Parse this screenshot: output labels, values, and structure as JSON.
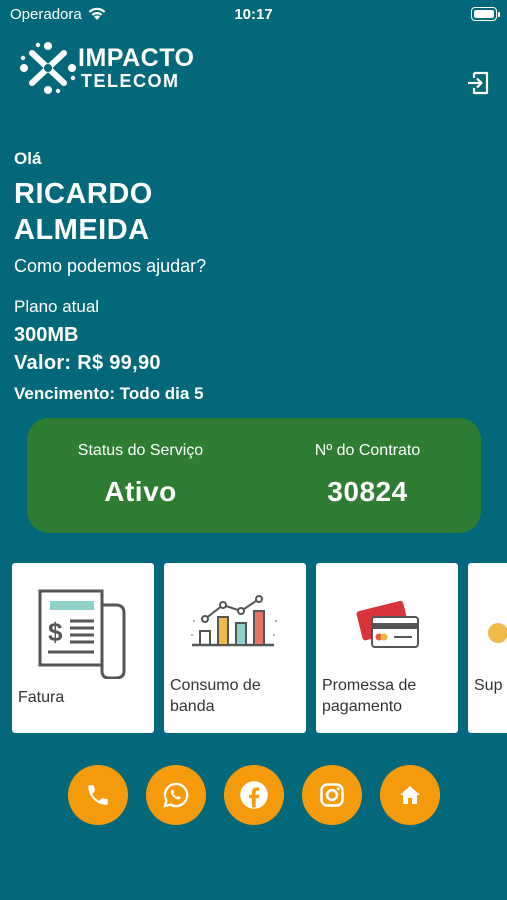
{
  "status_bar": {
    "carrier": "Operadora",
    "time": "10:17"
  },
  "brand": {
    "line1": "IMPACTO",
    "line2": "TELECOM"
  },
  "greeting": {
    "hello": "Olá",
    "name": "RICARDO ALMEIDA",
    "help": "Como podemos ajudar?"
  },
  "plan": {
    "label": "Plano atual",
    "name": "300MB",
    "price": "Valor: R$ 99,90",
    "due": "Vencimento: Todo dia 5"
  },
  "status_card": {
    "service_label": "Status do Serviço",
    "service_value": "Ativo",
    "contract_label": "Nº do Contrato",
    "contract_value": "30824",
    "color": "#2e7d33"
  },
  "tiles": [
    {
      "label": "Fatura",
      "icon": "invoice-icon"
    },
    {
      "label": "Consumo de banda",
      "icon": "bandwidth-chart-icon"
    },
    {
      "label": "Promessa de pagamento",
      "icon": "credit-card-icon"
    },
    {
      "label": "Sup",
      "icon": "support-icon"
    }
  ],
  "actions": [
    {
      "icon": "phone-icon"
    },
    {
      "icon": "whatsapp-icon"
    },
    {
      "icon": "facebook-icon"
    },
    {
      "icon": "instagram-icon"
    },
    {
      "icon": "home-icon"
    }
  ],
  "colors": {
    "background": "#03697a",
    "accent": "#f59b0b",
    "card": "#2e7d33"
  }
}
